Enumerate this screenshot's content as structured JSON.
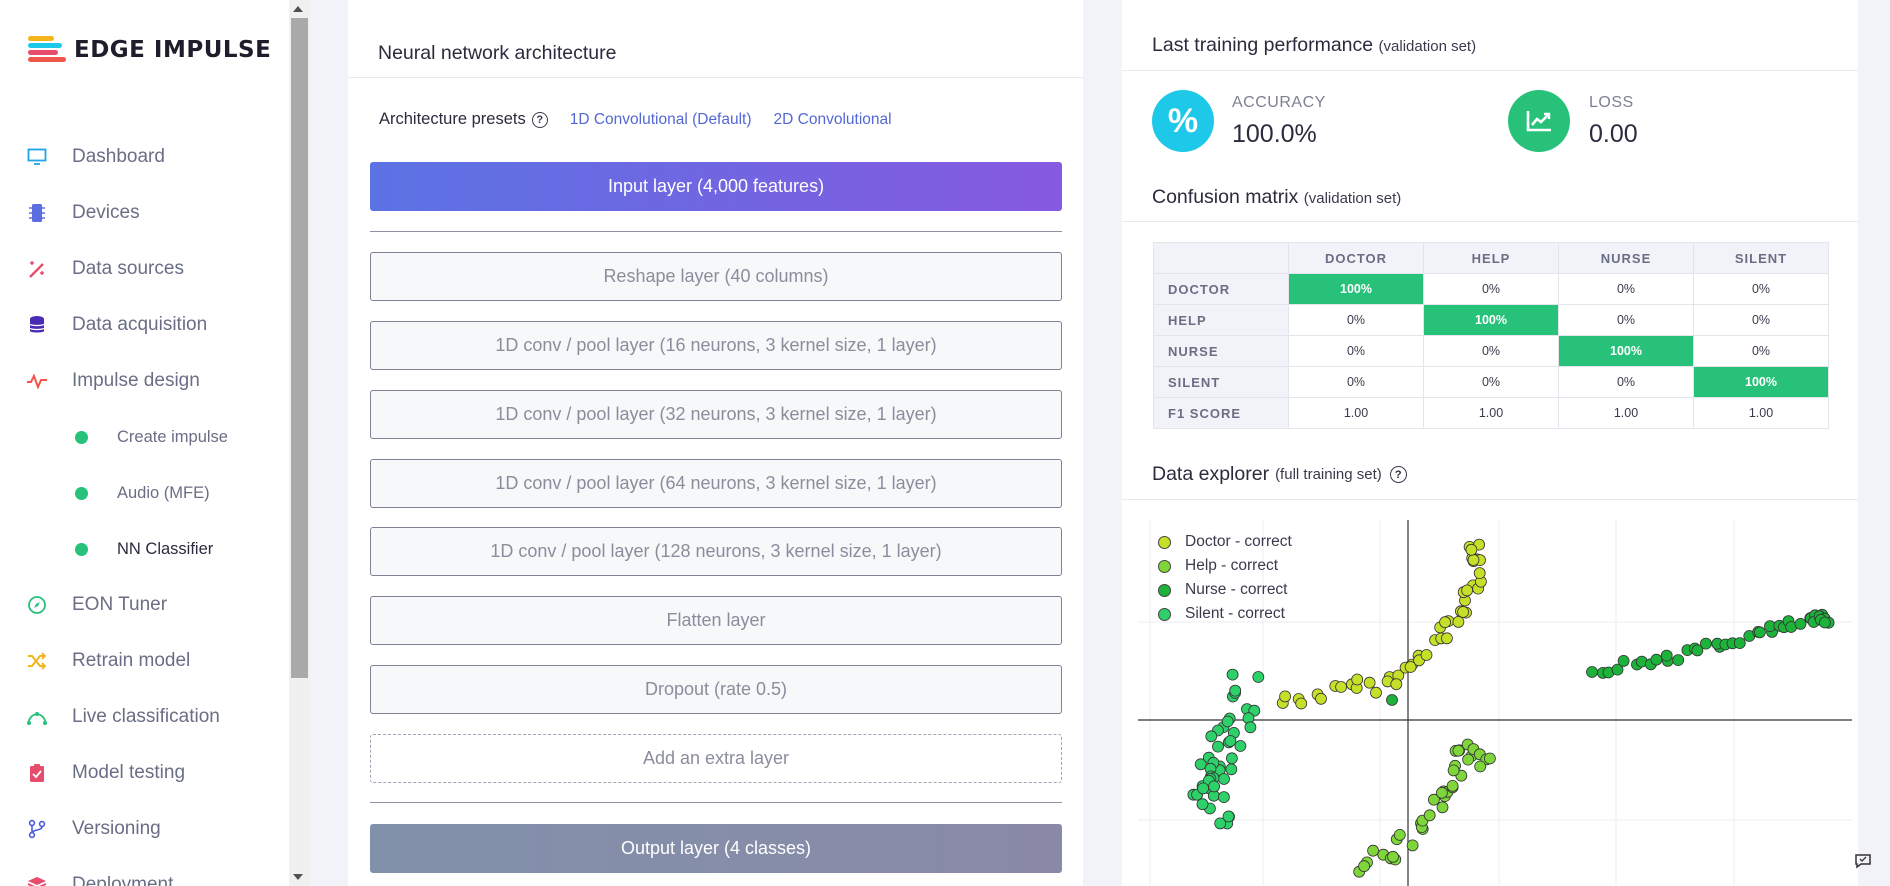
{
  "sidebar": {
    "logo_text": "EDGE IMPULSE",
    "items": [
      {
        "label": "Dashboard",
        "icon": "monitor-icon",
        "color": "#1ea5e8"
      },
      {
        "label": "Devices",
        "icon": "chip-icon",
        "color": "#5b6ee1"
      },
      {
        "label": "Data sources",
        "icon": "wand-icon",
        "color": "#e84c6d"
      },
      {
        "label": "Data acquisition",
        "icon": "database-icon",
        "color": "#4a2bb5"
      },
      {
        "label": "Impulse design",
        "icon": "pulse-icon",
        "color": "#f0554a"
      }
    ],
    "subitems": [
      {
        "label": "Create impulse"
      },
      {
        "label": "Audio (MFE)"
      },
      {
        "label": "NN Classifier"
      }
    ],
    "items_after": [
      {
        "label": "EON Tuner",
        "icon": "compass-icon",
        "color": "#27c17a"
      },
      {
        "label": "Retrain model",
        "icon": "shuffle-icon",
        "color": "#f3b51b"
      },
      {
        "label": "Live classification",
        "icon": "curve-icon",
        "color": "#27c17a"
      },
      {
        "label": "Model testing",
        "icon": "clipboard-icon",
        "color": "#e84c6d"
      },
      {
        "label": "Versioning",
        "icon": "branch-icon",
        "color": "#4a5bd6"
      },
      {
        "label": "Deployment",
        "icon": "box-icon",
        "color": "#e84c6d"
      }
    ]
  },
  "architecture": {
    "title": "Neural network architecture",
    "presets_label": "Architecture presets",
    "help_glyph": "?",
    "preset_1d": "1D Convolutional (Default)",
    "preset_2d": "2D Convolutional",
    "input_layer": "Input layer (4,000 features)",
    "layers": [
      "Reshape layer (40 columns)",
      "1D conv / pool layer (16 neurons, 3 kernel size, 1 layer)",
      "1D conv / pool layer (32 neurons, 3 kernel size, 1 layer)",
      "1D conv / pool layer (64 neurons, 3 kernel size, 1 layer)",
      "1D conv / pool layer (128 neurons, 3 kernel size, 1 layer)",
      "Flatten layer",
      "Dropout (rate 0.5)"
    ],
    "add_layer": "Add an extra layer",
    "output_layer": "Output layer (4 classes)"
  },
  "performance": {
    "title": "Last training performance",
    "subtitle": "(validation set)",
    "accuracy_label": "ACCURACY",
    "accuracy_value": "100.0%",
    "accuracy_glyph": "%",
    "loss_label": "LOSS",
    "loss_value": "0.00",
    "accent_accuracy": "#1ec8e8",
    "accent_loss": "#27c17a"
  },
  "confusion": {
    "title": "Confusion matrix",
    "subtitle": "(validation set)",
    "columns": [
      "DOCTOR",
      "HELP",
      "NURSE",
      "SILENT"
    ],
    "rows": [
      {
        "label": "DOCTOR",
        "cells": [
          "100%",
          "0%",
          "0%",
          "0%"
        ]
      },
      {
        "label": "HELP",
        "cells": [
          "0%",
          "100%",
          "0%",
          "0%"
        ]
      },
      {
        "label": "NURSE",
        "cells": [
          "0%",
          "0%",
          "100%",
          "0%"
        ]
      },
      {
        "label": "SILENT",
        "cells": [
          "0%",
          "0%",
          "0%",
          "100%"
        ]
      }
    ],
    "f1_label": "F1 SCORE",
    "f1": [
      "1.00",
      "1.00",
      "1.00",
      "1.00"
    ]
  },
  "explorer": {
    "title": "Data explorer",
    "subtitle": "(full training set)",
    "help_glyph": "?",
    "legend": [
      {
        "label": "Doctor - correct",
        "color": "#c6e02a"
      },
      {
        "label": "Help - correct",
        "color": "#7fd63a"
      },
      {
        "label": "Nurse - correct",
        "color": "#1db33a"
      },
      {
        "label": "Silent - correct",
        "color": "#2ed06a"
      }
    ]
  }
}
